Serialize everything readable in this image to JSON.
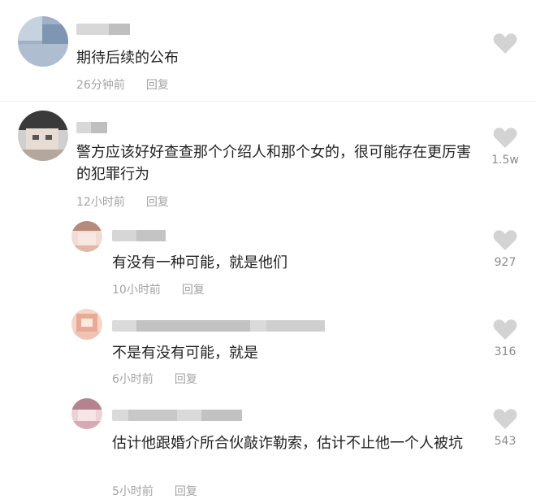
{
  "comments": [
    {
      "text": "期待后续的公布",
      "time": "26分钟前",
      "reply": "回复",
      "likes": ""
    },
    {
      "text": "警方应该好好查查那个介绍人和那个女的，很可能存在更厉害的犯罪行为",
      "time": "12小时前",
      "reply": "回复",
      "likes": "1.5w"
    },
    {
      "text": "有没有一种可能，就是他们",
      "time": "10小时前",
      "reply": "回复",
      "likes": "927"
    },
    {
      "text": "不是有没有可能，就是",
      "time": "6小时前",
      "reply": "回复",
      "likes": "316"
    },
    {
      "text": "估计他跟婚介所合伙敲诈勒索，估计不止他一个人被坑",
      "time": "5小时前",
      "reply": "回复",
      "likes": "543"
    }
  ],
  "icons": {
    "like": "heart-icon"
  },
  "colors": {
    "heart": "#d3d3d3",
    "meta": "#a3a3a3",
    "text": "#222222"
  }
}
